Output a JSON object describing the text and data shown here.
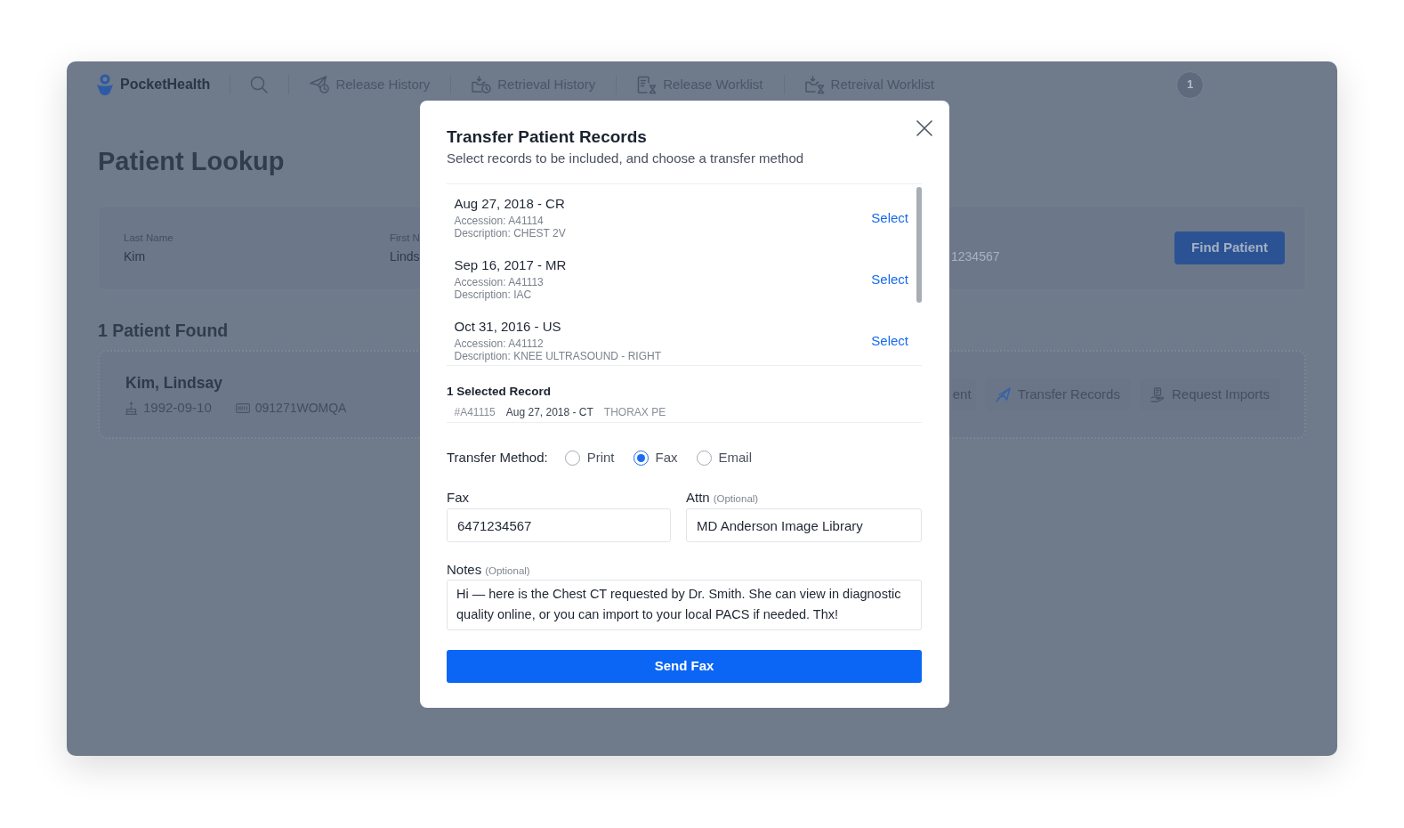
{
  "nav": {
    "brand": "PocketHealth",
    "items": [
      {
        "label": "Release History"
      },
      {
        "label": "Retrieval History"
      },
      {
        "label": "Release Worklist"
      },
      {
        "label": "Retreival Worklist"
      }
    ],
    "account": "1"
  },
  "page_title": "Patient Lookup",
  "search": {
    "fields": [
      {
        "label": "Last Name",
        "value": "Kim"
      },
      {
        "label": "First N",
        "value": "Linds"
      }
    ],
    "field_3": {
      "placeholder": "1234567"
    },
    "button": "Find Patient"
  },
  "results": {
    "heading": "1 Patient Found",
    "patients": [
      {
        "name": "Kim, Lindsay",
        "dob": "1992-09-10",
        "mrn": "091271WOMQA",
        "actions": [
          {
            "label": "ent"
          },
          {
            "label": "Transfer Records"
          },
          {
            "label": "Request Imports"
          }
        ]
      }
    ]
  },
  "modal": {
    "title": "Transfer Patient Records",
    "subtitle": "Select records to be included, and choose a transfer method",
    "records": [
      {
        "title": "Aug 27, 2018 - CR",
        "accession": "Accession: A41114",
        "description": "Description: CHEST 2V",
        "action": "Select"
      },
      {
        "title": "Sep 16, 2017 - MR",
        "accession": "Accession: A41113",
        "description": "Description: IAC",
        "action": "Select"
      },
      {
        "title": "Oct 31, 2016 - US",
        "accession": "Accession: A41112",
        "description": "Description: KNEE ULTRASOUND - RIGHT",
        "action": "Select"
      }
    ],
    "selected_heading": "1 Selected Record",
    "selected_records": [
      {
        "id": "#A41115",
        "title": "Aug 27, 2018 - CT",
        "description": "THORAX PE"
      }
    ],
    "transfer_method": {
      "label": "Transfer Method:",
      "options": [
        {
          "label": "Print",
          "selected": false
        },
        {
          "label": "Fax",
          "selected": true
        },
        {
          "label": "Email",
          "selected": false
        }
      ]
    },
    "fields": [
      {
        "label": "Fax",
        "value": "6471234567"
      },
      {
        "label": "Attn",
        "qualifier": "(Optional)",
        "value": "MD Anderson Image Library"
      }
    ],
    "notes": {
      "label": "Notes",
      "qualifier": "(Optional)",
      "value": "Hi — here is the Chest CT requested by Dr. Smith. She can view in diagnostic quality online, or you can import to your local PACS if needed. Thx!"
    },
    "submit": "Send Fax"
  }
}
